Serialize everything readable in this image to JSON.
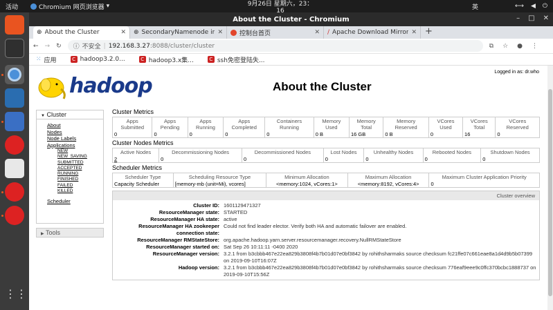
{
  "system": {
    "activities": "活动",
    "app_name": "Chromium 网页浏览器",
    "clock": "9月26日 星期六，23：16",
    "ime": "英"
  },
  "window": {
    "title": "About the Cluster - Chromium"
  },
  "tabs": [
    {
      "label": "About the Cluster"
    },
    {
      "label": "SecondaryNamenode info"
    },
    {
      "label": "控制台首页"
    },
    {
      "label": "Apache Download Mirrors"
    }
  ],
  "omnibox": {
    "security": "不安全",
    "host": "192.168.3.27",
    "path": ":8088/cluster/cluster"
  },
  "bookmarks": [
    {
      "label": "应用"
    },
    {
      "label": "hadoop3.2.0..."
    },
    {
      "label": "hadoop3.x集..."
    },
    {
      "label": "ssh免密登陆失..."
    }
  ],
  "page": {
    "logged_in": "Logged in as: dr.who",
    "logo_text": "hadoop",
    "title": "About the Cluster"
  },
  "nav": {
    "cluster_label": "Cluster",
    "links": [
      "About",
      "Nodes",
      "Node Labels",
      "Applications"
    ],
    "app_states": [
      "NEW",
      "NEW_SAVING",
      "SUBMITTED",
      "ACCEPTED",
      "RUNNING",
      "FINISHED",
      "FAILED",
      "KILLED"
    ],
    "scheduler": "Scheduler",
    "tools_label": "Tools"
  },
  "cluster_metrics": {
    "heading": "Cluster Metrics",
    "headers": [
      "Apps Submitted",
      "Apps Pending",
      "Apps Running",
      "Apps Completed",
      "Containers Running",
      "Memory Used",
      "Memory Total",
      "Memory Reserved",
      "VCores Used",
      "VCores Total",
      "VCores Reserved"
    ],
    "values": [
      "0",
      "0",
      "0",
      "0",
      "0",
      "0 B",
      "16 GB",
      "0 B",
      "0",
      "16",
      "0"
    ]
  },
  "nodes_metrics": {
    "heading": "Cluster Nodes Metrics",
    "headers": [
      "Active Nodes",
      "Decommissioning Nodes",
      "Decommissioned Nodes",
      "Lost Nodes",
      "Unhealthy Nodes",
      "Rebooted Nodes",
      "Shutdown Nodes"
    ],
    "values": [
      "2",
      "0",
      "0",
      "0",
      "0",
      "0",
      "0"
    ]
  },
  "scheduler_metrics": {
    "heading": "Scheduler Metrics",
    "headers": [
      "Scheduler Type",
      "Scheduling Resource Type",
      "Minimum Allocation",
      "Maximum Allocation",
      "Maximum Cluster Application Priority"
    ],
    "values": [
      "Capacity Scheduler",
      "[memory-mb (unit=Mi), vcores]",
      "<memory:1024, vCores:1>",
      "<memory:8192, vCores:4>",
      "0"
    ]
  },
  "overview": {
    "heading": "Cluster overview",
    "rows": [
      {
        "key": "Cluster ID:",
        "value": "1601129471327"
      },
      {
        "key": "ResourceManager state:",
        "value": "STARTED"
      },
      {
        "key": "ResourceManager HA state:",
        "value": "active"
      },
      {
        "key": "ResourceManager HA zookeeper connection state:",
        "value": "Could not find leader elector. Verify both HA and automatic failover are enabled."
      },
      {
        "key": "ResourceManager RMStateStore:",
        "value": "org.apache.hadoop.yarn.server.resourcemanager.recovery.NullRMStateStore"
      },
      {
        "key": "ResourceManager started on:",
        "value": "Sat Sep 26 10:11:11 -0400 2020"
      },
      {
        "key": "ResourceManager version:",
        "value": "3.2.1 from b3cbbb467e22ea829b3808f4b7b01d07e0bf3842 by rohithsharmaks source checksum fc21ffe07c661eae8a1d4d9b5b07399 on 2019-09-10T16:07Z"
      },
      {
        "key": "Hadoop version:",
        "value": "3.2.1 from b3cbbb467e22ea829b3808f4b7b01d07e0bf3842 by rohithsharmaks source checksum 776eaf9eee9c0ffc370bcbc1888737 on 2019-09-10T15:56Z"
      }
    ]
  }
}
